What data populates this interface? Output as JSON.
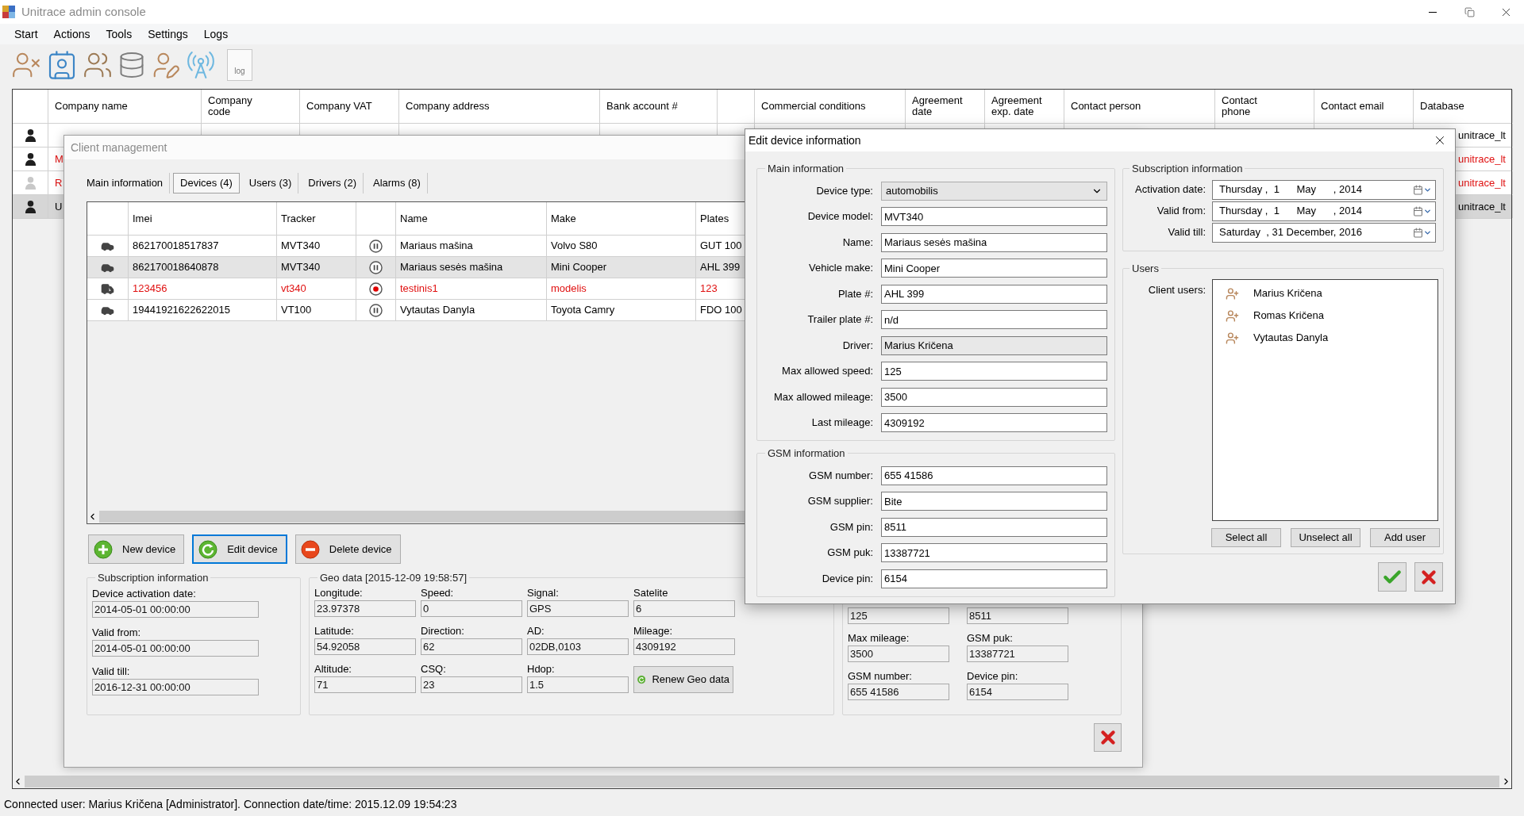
{
  "window": {
    "title": "Unitrace admin console"
  },
  "menu": [
    "Start",
    "Actions",
    "Tools",
    "Settings",
    "Logs"
  ],
  "toolbar": {
    "log_label": "log"
  },
  "companies": {
    "columns": [
      {
        "label": "Company name",
        "wrap": false
      },
      {
        "label": "Company code",
        "wrap": true
      },
      {
        "label": "Company VAT",
        "wrap": false
      },
      {
        "label": "Company address",
        "wrap": false
      },
      {
        "label": "Bank account #",
        "wrap": false
      },
      {
        "label": "Commercial conditions",
        "wrap": false
      },
      {
        "label": "Agreement date",
        "wrap": true
      },
      {
        "label": "Agreement exp. date",
        "wrap": true
      },
      {
        "label": "Contact person",
        "wrap": false
      },
      {
        "label": "Contact phone",
        "wrap": true
      },
      {
        "label": "Contact email",
        "wrap": false
      },
      {
        "label": "Database"
      }
    ],
    "rows": [
      {
        "database": "unitrace_lt",
        "highlighted": false,
        "inactive": false,
        "selected": false
      },
      {
        "company_name": "M",
        "database": "unitrace_lt",
        "highlighted": true,
        "inactive": false,
        "selected": false
      },
      {
        "company_name": "R",
        "database": "unitrace_lt",
        "highlighted": true,
        "inactive": true,
        "selected": false
      },
      {
        "company_name": "U",
        "database": "unitrace_lt",
        "highlighted": false,
        "inactive": false,
        "selected": true
      }
    ]
  },
  "client_window": {
    "title": "Client management",
    "tabs": [
      {
        "label": "Main information",
        "selected": false
      },
      {
        "label": "Devices (4)",
        "selected": true
      },
      {
        "label": "Users (3)",
        "selected": false
      },
      {
        "label": "Drivers (2)",
        "selected": false
      },
      {
        "label": "Alarms (8)",
        "selected": false
      }
    ],
    "devices": {
      "columns": {
        "imei": "Imei",
        "tracker": "Tracker",
        "name": "Name",
        "make": "Make",
        "plates": "Plates"
      },
      "rows": [
        {
          "kind": "car",
          "imei": "862170018517837",
          "tracker": "MVT340",
          "recording": false,
          "name": "Mariaus mašina",
          "make": "Volvo S80",
          "plates": "GUT 100",
          "alert": false,
          "selected": false
        },
        {
          "kind": "car",
          "imei": "862170018640878",
          "tracker": "MVT340",
          "recording": false,
          "name": "Mariaus sesės mašina",
          "make": "Mini Cooper",
          "plates": "AHL 399",
          "alert": false,
          "selected": true
        },
        {
          "kind": "truck",
          "imei": "123456",
          "tracker": "vt340",
          "recording": true,
          "name": "testinis1",
          "make": "modelis",
          "plates": "123",
          "alert": true,
          "selected": false
        },
        {
          "kind": "car",
          "imei": "19441921622622015",
          "tracker": "VT100",
          "recording": false,
          "name": "Vytautas Danyla",
          "make": "Toyota Camry",
          "plates": "FDO 100",
          "alert": false,
          "selected": false
        }
      ]
    },
    "buttons": [
      {
        "kind": "add",
        "label": "New device",
        "focused": false
      },
      {
        "kind": "edit",
        "label": "Edit device",
        "focused": true
      },
      {
        "kind": "delete",
        "label": "Delete device",
        "focused": false
      }
    ],
    "subscription": {
      "title": "Subscription information",
      "fields": [
        {
          "label": "Device activation date:",
          "value": "2014-05-01 00:00:00"
        },
        {
          "label": "Valid from:",
          "value": "2014-05-01 00:00:00"
        },
        {
          "label": "Valid till:",
          "value": "2016-12-31 00:00:00"
        }
      ]
    },
    "geo": {
      "title": "Geo data [2015-12-09 19:58:57]",
      "fields": [
        {
          "label": "Longitude:",
          "value": "23.97378"
        },
        {
          "label": "Speed:",
          "value": "0"
        },
        {
          "label": "Signal:",
          "value": "GPS"
        },
        {
          "label": "Satelite",
          "value": "6"
        },
        {
          "label": "Latitude:",
          "value": "54.92058"
        },
        {
          "label": "Direction:",
          "value": "62"
        },
        {
          "label": "AD:",
          "value": "02DB,0103"
        },
        {
          "label": "Mileage:",
          "value": "4309192"
        },
        {
          "label": "Altitude:",
          "value": "71"
        },
        {
          "label": "CSQ:",
          "value": "23"
        },
        {
          "label": "Hdop:",
          "value": "1.5"
        }
      ],
      "renew_button": "Renew Geo data"
    },
    "limits": {
      "fields": [
        {
          "value": "125"
        },
        {
          "value": "8511"
        },
        {
          "label": "Max mileage:",
          "value": "3500"
        },
        {
          "label": "GSM puk:",
          "value": "13387721"
        },
        {
          "label": "GSM number:",
          "value": "655 41586"
        },
        {
          "label": "Device pin:",
          "value": "6154"
        }
      ]
    }
  },
  "edit_dialog": {
    "title": "Edit device information",
    "main": {
      "title": "Main information",
      "fields": [
        {
          "kind": "select",
          "label": "Device type:",
          "value": "automobilis"
        },
        {
          "kind": "text",
          "label": "Device model:",
          "value": "MVT340"
        },
        {
          "kind": "text",
          "label": "Name:",
          "value": "Mariaus sesės mašina"
        },
        {
          "kind": "text",
          "label": "Vehicle make:",
          "value": "Mini Cooper"
        },
        {
          "kind": "text",
          "label": "Plate #:",
          "value": "AHL 399"
        },
        {
          "kind": "text",
          "label": "Trailer plate #:",
          "value": "n/d"
        },
        {
          "kind": "readonly",
          "label": "Driver:",
          "value": "Marius Kričena"
        },
        {
          "kind": "text",
          "label": "Max allowed speed:",
          "value": "125"
        },
        {
          "kind": "text",
          "label": "Max allowed mileage:",
          "value": "3500"
        },
        {
          "kind": "text",
          "label": "Last mileage:",
          "value": "4309192"
        }
      ]
    },
    "gsm": {
      "title": "GSM information",
      "fields": [
        {
          "kind": "text",
          "label": "GSM number:",
          "value": "655 41586"
        },
        {
          "kind": "text",
          "label": "GSM supplier:",
          "value": "Bite"
        },
        {
          "kind": "text",
          "label": "GSM pin:",
          "value": "8511"
        },
        {
          "kind": "text",
          "label": "GSM puk:",
          "value": "13387721"
        },
        {
          "kind": "text",
          "label": "Device pin:",
          "value": "6154"
        }
      ]
    },
    "subscription": {
      "title": "Subscription information",
      "fields": [
        {
          "label": "Activation date:",
          "value": "Thursday ,  1      May      , 2014"
        },
        {
          "label": "Valid from:",
          "value": "Thursday ,  1      May      , 2014"
        },
        {
          "label": "Valid till:",
          "value": "Saturday  , 31 December, 2016"
        }
      ]
    },
    "users": {
      "title": "Users",
      "label": "Client users:",
      "items": [
        "Marius Kričena",
        "Romas Kričena",
        "Vytautas Danyla"
      ],
      "buttons": [
        "Select all",
        "Unselect all",
        "Add user"
      ]
    }
  },
  "status_bar": "Connected user: Marius Kričena [Administrator]. Connection date/time: 2015.12.09 19:54:23"
}
